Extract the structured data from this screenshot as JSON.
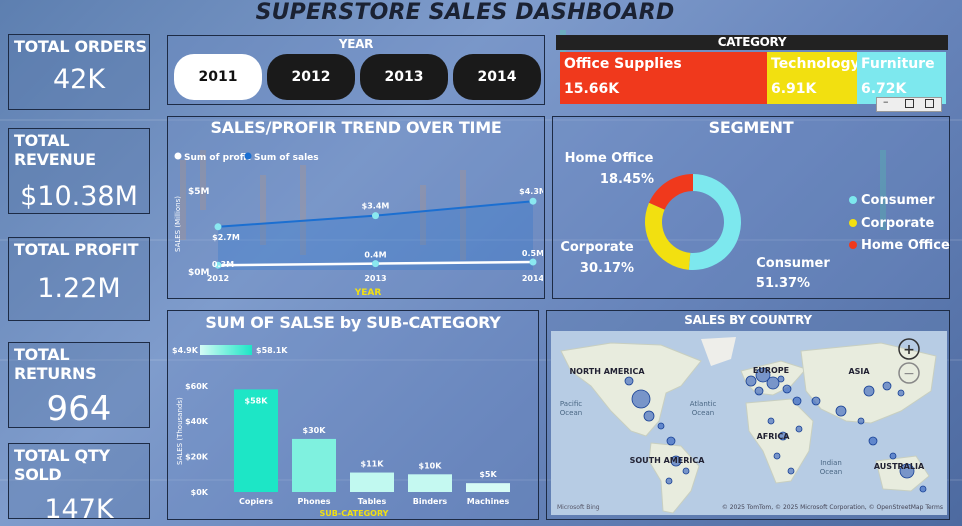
{
  "dashboard": {
    "title": "SUPERSTORE SALES DASHBOARD"
  },
  "kpis": [
    {
      "label": "TOTAL ORDERS",
      "value": "42K"
    },
    {
      "label": "TOTAL REVENUE",
      "value": "$10.38M"
    },
    {
      "label": "TOTAL PROFIT",
      "value": "1.22M"
    },
    {
      "label": "TOTAL RETURNS",
      "value": "964"
    },
    {
      "label": "TOTAL QTY SOLD",
      "value": "147K"
    }
  ],
  "year_filter": {
    "title": "YEAR",
    "options": [
      "2011",
      "2012",
      "2013",
      "2014"
    ],
    "selected": "2011"
  },
  "category": {
    "title": "CATEGORY",
    "items": [
      {
        "name": "Office Supplies",
        "value": "15.66K",
        "color": "#f0391c"
      },
      {
        "name": "Technology",
        "value": "6.91K",
        "color": "#f2e010"
      },
      {
        "name": "Furniture",
        "value": "6.72K",
        "color": "#7de8ee"
      }
    ]
  },
  "colors": {
    "profit": "#ffffff",
    "sales": "#1b6fd1",
    "consumer": "#7de8ee",
    "corporate": "#f2e010",
    "home_office": "#f0391c",
    "bar_top": "#1de6c6"
  },
  "trend": {
    "title": "SALES/PROFIR TREND OVER TIME",
    "legend_profit": "Sum of profit",
    "legend_sales": "Sum of sales",
    "xlabel": "YEAR",
    "ylabel": "SALES (Millions)",
    "yticks": [
      "$5M",
      "$0M"
    ]
  },
  "segment": {
    "title": "SEGMENT",
    "labels": [
      {
        "name": "Home Office",
        "pct": "18.45%"
      },
      {
        "name": "Corporate",
        "pct": "30.17%"
      },
      {
        "name": "Consumer",
        "pct": "51.37%"
      }
    ],
    "legend": [
      "Consumer",
      "Corporate",
      "Home Office"
    ]
  },
  "subcat": {
    "title": "SUM OF SALSE by SUB-CATEGORY",
    "range_min": "$4.9K",
    "range_max": "$58.1K",
    "xlabel": "SUB-CATEGORY",
    "ylabel": "SALES (Thousands)",
    "yticks": [
      "$60K",
      "$40K",
      "$20K",
      "$0K"
    ]
  },
  "country": {
    "title": "SALES BY COUNTRY",
    "labels": [
      "NORTH AMERICA",
      "EUROPE",
      "ASIA",
      "AFRICA",
      "SOUTH AMERICA",
      "AUSTRALIA",
      "Atlantic",
      "Ocean",
      "Pacific",
      "Ocean",
      "Indian",
      "Ocean"
    ],
    "attribution": "© 2025 TomTom, © 2025 Microsoft Corporation, © OpenStreetMap  Terms",
    "bing": "Microsoft Bing",
    "zoom_in": "+",
    "zoom_out": "−"
  },
  "chart_data": [
    {
      "type": "line",
      "x": [
        2012,
        2013,
        2014
      ],
      "series": [
        {
          "name": "Sum of profit",
          "values": [
            0.3,
            0.4,
            0.5
          ],
          "labels": [
            "0.3M",
            "0.4M",
            "0.5M"
          ]
        },
        {
          "name": "Sum of sales",
          "values": [
            2.7,
            3.4,
            4.3
          ],
          "labels": [
            "$2.7M",
            "$3.4M",
            "$4.3M"
          ]
        }
      ],
      "title": "SALES/PROFIR TREND OVER TIME",
      "xlabel": "YEAR",
      "ylabel": "SALES (Millions)",
      "ylim": [
        0,
        5
      ]
    },
    {
      "type": "pie",
      "categories": [
        "Consumer",
        "Corporate",
        "Home Office"
      ],
      "values": [
        51.37,
        30.17,
        18.45
      ],
      "title": "SEGMENT"
    },
    {
      "type": "bar",
      "categories": [
        "Copiers",
        "Phones",
        "Tables",
        "Binders",
        "Machines"
      ],
      "values": [
        58,
        30,
        11,
        10,
        5
      ],
      "labels": [
        "$58K",
        "$30K",
        "$11K",
        "$10K",
        "$5K"
      ],
      "title": "SUM OF SALSE by SUB-CATEGORY",
      "xlabel": "SUB-CATEGORY",
      "ylabel": "SALES (Thousands)",
      "ylim": [
        0,
        65
      ]
    }
  ]
}
